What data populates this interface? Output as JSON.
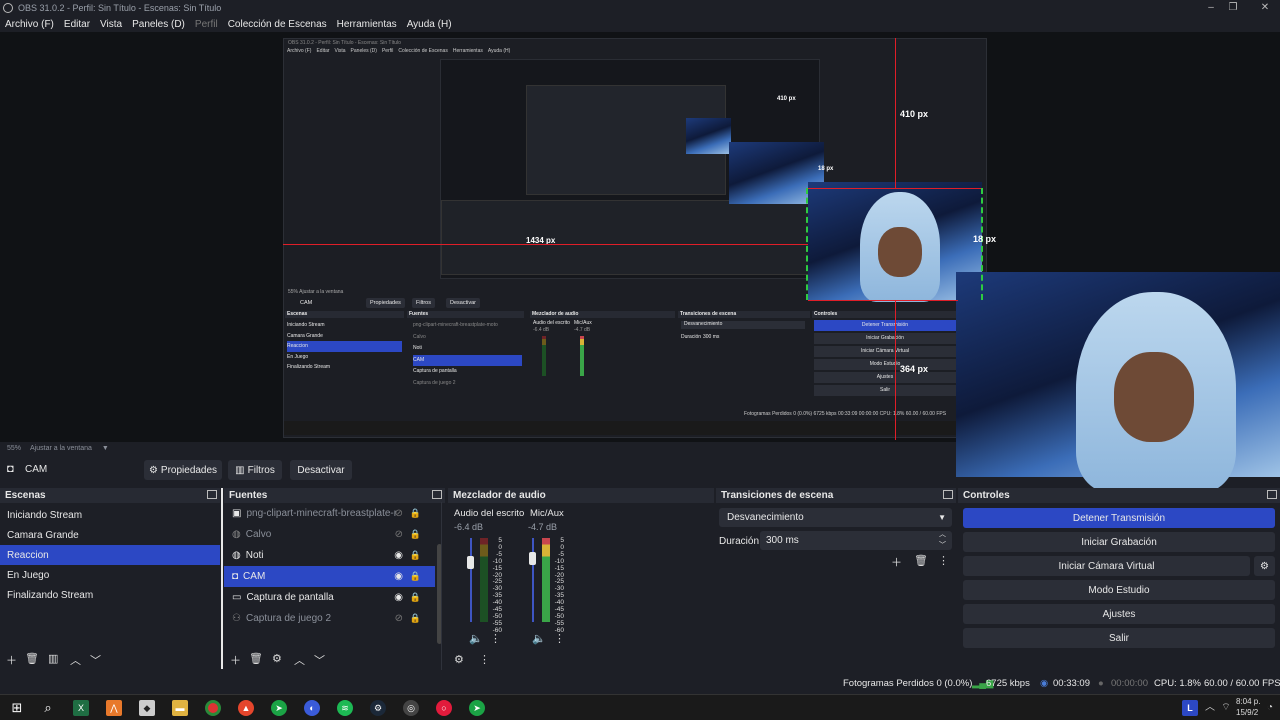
{
  "window": {
    "title": "OBS 31.0.2 - Perfil: Sin Título - Escenas: Sin Título",
    "min": "–",
    "max": "❐",
    "close": "✕"
  },
  "menu": [
    "Archivo (F)",
    "Editar",
    "Vista",
    "Paneles (D)",
    "Perfil",
    "Colección de Escenas",
    "Herramientas",
    "Ayuda (H)"
  ],
  "preview": {
    "labels": {
      "a": "410 px",
      "b": "18 px",
      "c": "1434 px",
      "d": "364 px",
      "e": "410 px",
      "f": "18 px"
    },
    "nested_title": "OBS 31.0.2 - Perfil: Sin Título - Escenas: Sin Título",
    "nested_menu": [
      "Archivo (F)",
      "Editar",
      "Vista",
      "Paneles (D)",
      "Perfil",
      "Colección de Escenas",
      "Herramientas",
      "Ayuda (H)"
    ],
    "nested_zoom": "55%   Ajustar a la ventana",
    "nested_source": "CAM",
    "nested_props": "Propiedades",
    "nested_filters": "Filtros",
    "nested_deactivate": "Desactivar",
    "nested_scenes_title": "Escenas",
    "nested_sources_title": "Fuentes",
    "nested_mixer_title": "Mezclador de audio",
    "nested_trans_title": "Transiciones de escena",
    "nested_controls_title": "Controles",
    "nested_scenes": [
      "Iniciando Stream",
      "Camara Grande",
      "Reaccion",
      "En Juego",
      "Finalizando Stream"
    ],
    "nested_sources": [
      "png-clipart-minecraft-breastplate-moto",
      "Calvo",
      "Noti",
      "CAM",
      "Captura de pantalla",
      "Captura de juego 2"
    ],
    "nested_mixer_ch1": "Audio del escrito",
    "nested_mixer_ch2": "Mic/Aux",
    "nested_mixer_db1": "-6.4 dB",
    "nested_mixer_db2": "-4.7 dB",
    "nested_transition": "Desvanecimiento",
    "nested_duration_label": "Duración",
    "nested_duration": "300 ms",
    "nested_controls": [
      "Detener Transmisión",
      "Iniciar Grabación",
      "Iniciar Cámara Virtual",
      "Modo Estudio",
      "Ajustes",
      "Salir"
    ],
    "nested_status": "Fotogramas Perdidos 0 (0.0%)   6725 kbps   00:33:09   00:00:00   CPU: 1.8%   60.00 / 60.00 FPS"
  },
  "zoom": {
    "level": "55%",
    "fit": "Ajustar a la ventana"
  },
  "source_bar": {
    "source": "CAM",
    "properties": "Propiedades",
    "filters": "Filtros",
    "deactivate": "Desactivar"
  },
  "scenes": {
    "title": "Escenas",
    "items": [
      "Iniciando Stream",
      "Camara Grande",
      "Reaccion",
      "En Juego",
      "Finalizando Stream"
    ],
    "selected": "Reaccion"
  },
  "sources": {
    "title": "Fuentes",
    "items": [
      {
        "label": "png-clipart-minecraft-breastplate-motc",
        "icon": "image-icon",
        "visible": false
      },
      {
        "label": "Calvo",
        "icon": "globe-icon",
        "visible": false
      },
      {
        "label": "Noti",
        "icon": "globe-icon",
        "visible": true
      },
      {
        "label": "CAM",
        "icon": "camera-icon",
        "visible": true
      },
      {
        "label": "Captura de pantalla",
        "icon": "monitor-icon",
        "visible": true
      },
      {
        "label": "Captura de juego 2",
        "icon": "gamepad-icon",
        "visible": false
      }
    ],
    "selected": "CAM"
  },
  "mixer": {
    "title": "Mezclador de audio",
    "channels": [
      {
        "name": "Audio del escrito",
        "db": "-6.4 dB",
        "active": false
      },
      {
        "name": "Mic/Aux",
        "db": "-4.7 dB",
        "active": true
      }
    ],
    "scale": [
      "5",
      "0",
      "-5",
      "-10",
      "-15",
      "-20",
      "-25",
      "-30",
      "-35",
      "-40",
      "-45",
      "-50",
      "-55",
      "-60"
    ]
  },
  "transitions": {
    "title": "Transiciones de escena",
    "type": "Desvanecimiento",
    "duration_label": "Duración",
    "duration": "300 ms"
  },
  "controls": {
    "title": "Controles",
    "stop_stream": "Detener Transmisión",
    "start_record": "Iniciar Grabación",
    "virtual_cam": "Iniciar Cámara Virtual",
    "studio_mode": "Modo Estudio",
    "settings": "Ajustes",
    "exit": "Salir"
  },
  "status": {
    "dropped": "Fotogramas Perdidos 0 (0.0%)",
    "bitrate": "6725 kbps",
    "stream_time": "00:33:09",
    "record_time": "00:00:00",
    "cpu": "CPU: 1.8%",
    "fps": "60.00 / 60.00 FPS"
  },
  "taskbar": {
    "time": "8:04 p.",
    "date": "15/9/2",
    "lang": "L"
  },
  "colors": {
    "accent": "#2c48c4",
    "guide": "#e01e28",
    "guide_green": "#2ecc40",
    "bg": "#1d1f26"
  }
}
